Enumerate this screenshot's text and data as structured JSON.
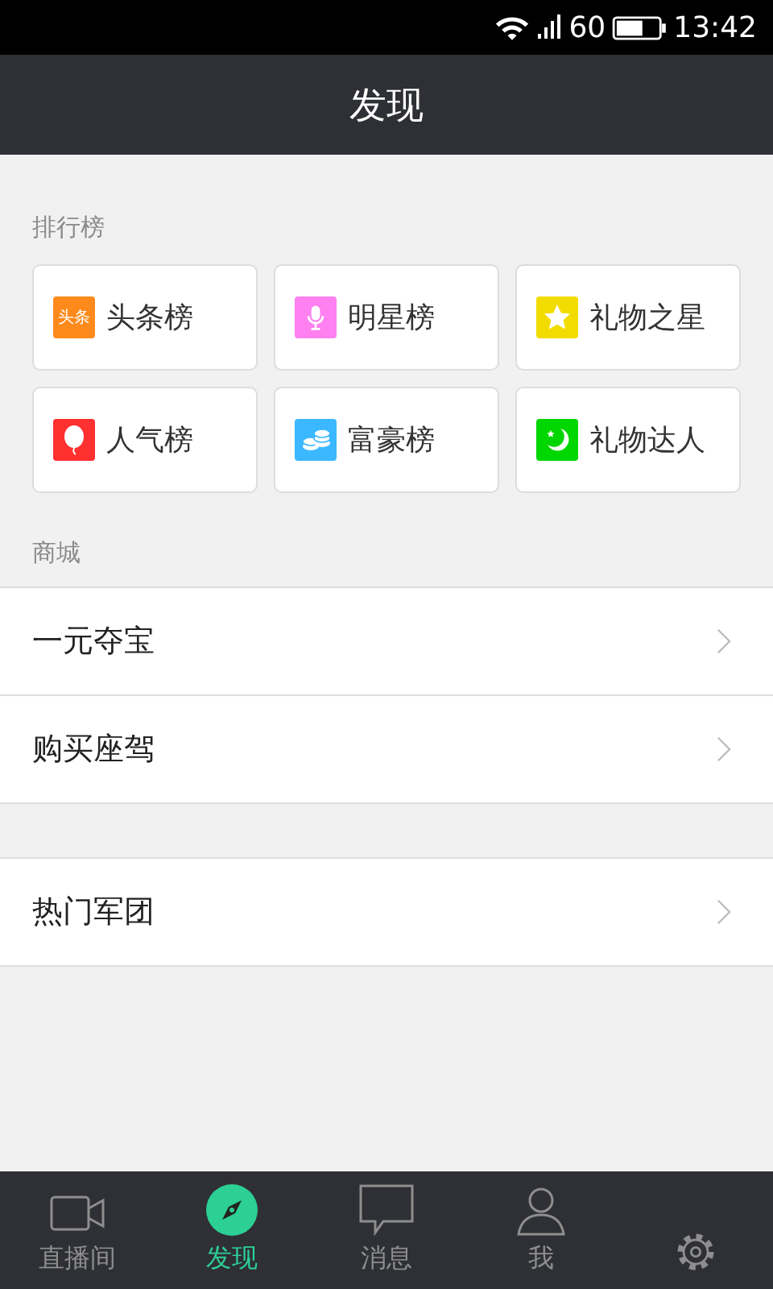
{
  "status_bar": {
    "battery_text": "60",
    "time": "13:42"
  },
  "header": {
    "title": "发现"
  },
  "ranking": {
    "heading": "排行榜",
    "items": [
      {
        "label": "头条榜",
        "kind": "text",
        "icon_text": "头条",
        "color": "#ff8a1c"
      },
      {
        "label": "明星榜",
        "kind": "mic",
        "color": "#ff80f0"
      },
      {
        "label": "礼物之星",
        "kind": "star",
        "color": "#f2dc00"
      },
      {
        "label": "人气榜",
        "kind": "balloon",
        "color": "#ff3030"
      },
      {
        "label": "富豪榜",
        "kind": "coins",
        "color": "#3bb8ff"
      },
      {
        "label": "礼物达人",
        "kind": "moon",
        "color": "#00d600"
      }
    ]
  },
  "shop": {
    "heading": "商城",
    "items": [
      {
        "label": "一元夺宝"
      },
      {
        "label": "购买座驾"
      }
    ]
  },
  "groups": {
    "items": [
      {
        "label": "热门军团"
      }
    ]
  },
  "tab_bar": [
    {
      "label": "直播间",
      "kind": "camera",
      "selected": false
    },
    {
      "label": "发现",
      "kind": "compass",
      "selected": true
    },
    {
      "label": "消息",
      "kind": "chat",
      "selected": false
    },
    {
      "label": "我",
      "kind": "person",
      "selected": false
    },
    {
      "kind": "gear",
      "selected": false
    }
  ]
}
